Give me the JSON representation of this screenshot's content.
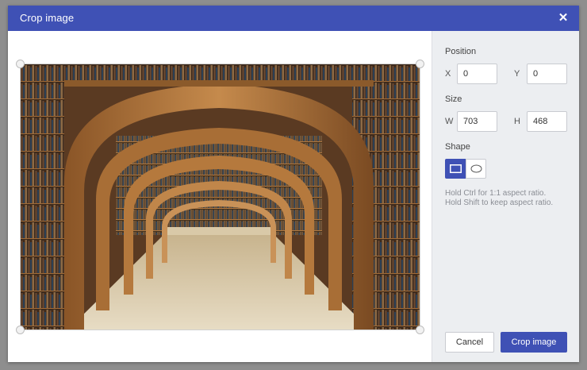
{
  "dialog": {
    "title": "Crop image",
    "close_icon": "close-icon"
  },
  "image": {
    "alt": "Library reading room with arched wooden bookshelves"
  },
  "panel": {
    "position_label": "Position",
    "x_label": "X",
    "x_value": "0",
    "y_label": "Y",
    "y_value": "0",
    "size_label": "Size",
    "w_label": "W",
    "w_value": "703",
    "h_label": "H",
    "h_value": "468",
    "shape_label": "Shape",
    "shape_selected": "rectangle",
    "hint_line1": "Hold Ctrl for 1:1 aspect ratio.",
    "hint_line2": "Hold Shift to keep aspect ratio."
  },
  "buttons": {
    "cancel": "Cancel",
    "crop": "Crop image"
  },
  "colors": {
    "accent": "#3f51b5",
    "panel_bg": "#eceef1",
    "overlay": "#8e8e8e"
  }
}
